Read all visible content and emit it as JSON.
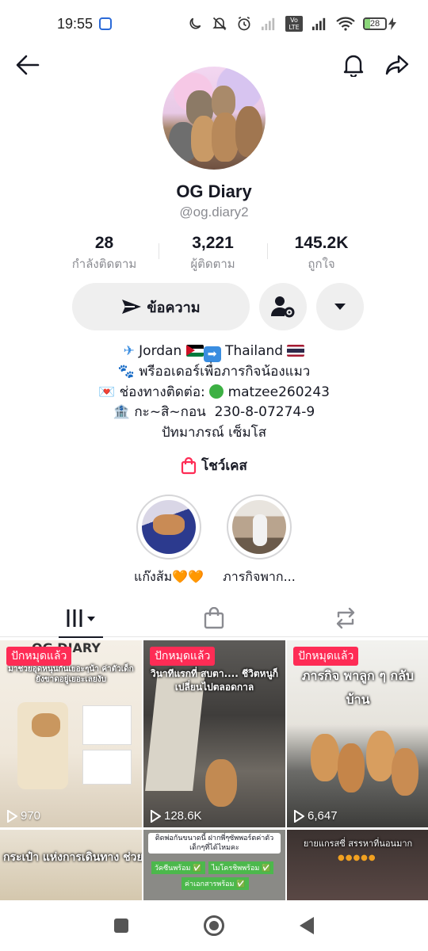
{
  "status": {
    "time": "19:55",
    "battery": "28",
    "battery_fraction": 0.28,
    "network_badge": "Vo LTE"
  },
  "profile": {
    "display_name": "OG Diary",
    "username": "@og.diary2"
  },
  "stats": [
    {
      "value": "28",
      "label": "กำลังติดตาม"
    },
    {
      "value": "3,221",
      "label": "ผู้ติดตาม"
    },
    {
      "value": "145.2K",
      "label": "ถูกใจ"
    }
  ],
  "actions": {
    "message_label": "ข้อความ"
  },
  "bio": {
    "line1_a": "Jordan",
    "line1_b": "Thailand",
    "line2": "พรีออเดอร์เพื่อภารกิจน้องแมว",
    "line3_a": "ช่องทางติดต่อ:",
    "line3_b": "matzee260243",
    "line4": "กะ~สิ~กอน  230-8-07274-9",
    "line5": "ปัทมาภรณ์ เซ็มโส"
  },
  "showcase_label": "โชว์เคส",
  "highlights": [
    {
      "label": "แก๊งส้ม🧡🧡"
    },
    {
      "label": "ภารกิจพาก..."
    }
  ],
  "videos": [
    {
      "badge": "ปักหมุดแล้ว",
      "views": "970",
      "caption_top": "OG DIARY",
      "caption": "มาช่วยอุดหนุนกันเยอะๆน้า ค่าตัวเด็กยังขาดอยู่เยอะเลยงับ"
    },
    {
      "badge": "ปักหมุดแล้ว",
      "views": "128.6K",
      "caption": "วินาทีแรกที่ สบตา.... ชีวิตหนูก็เปลี่ยนไปตลอดกาล"
    },
    {
      "badge": "ปักหมุดแล้ว",
      "views": "6,647",
      "caption": "ภารกิจ พาลูก ๆ กลับ บ้าน"
    },
    {
      "caption": "กระเป๋า แห่งการเดินทาง ช่วยกันส่งเด็กๆกลับไทยที่"
    },
    {
      "caption": "ติดพ่อกันขนาดนี้ ฝากพี่ๆซัพพอร์ตค่าตัวเด็กๆที่ได้ไหมคะ",
      "chips": [
        "วัคซีนพร้อม ✅",
        "ไมโครชิพพร้อม ✅",
        "ค่าเอกสารพร้อม ✅"
      ]
    },
    {
      "caption": "ยายแกรสซี่ สรรหาที่นอนมาก"
    }
  ]
}
